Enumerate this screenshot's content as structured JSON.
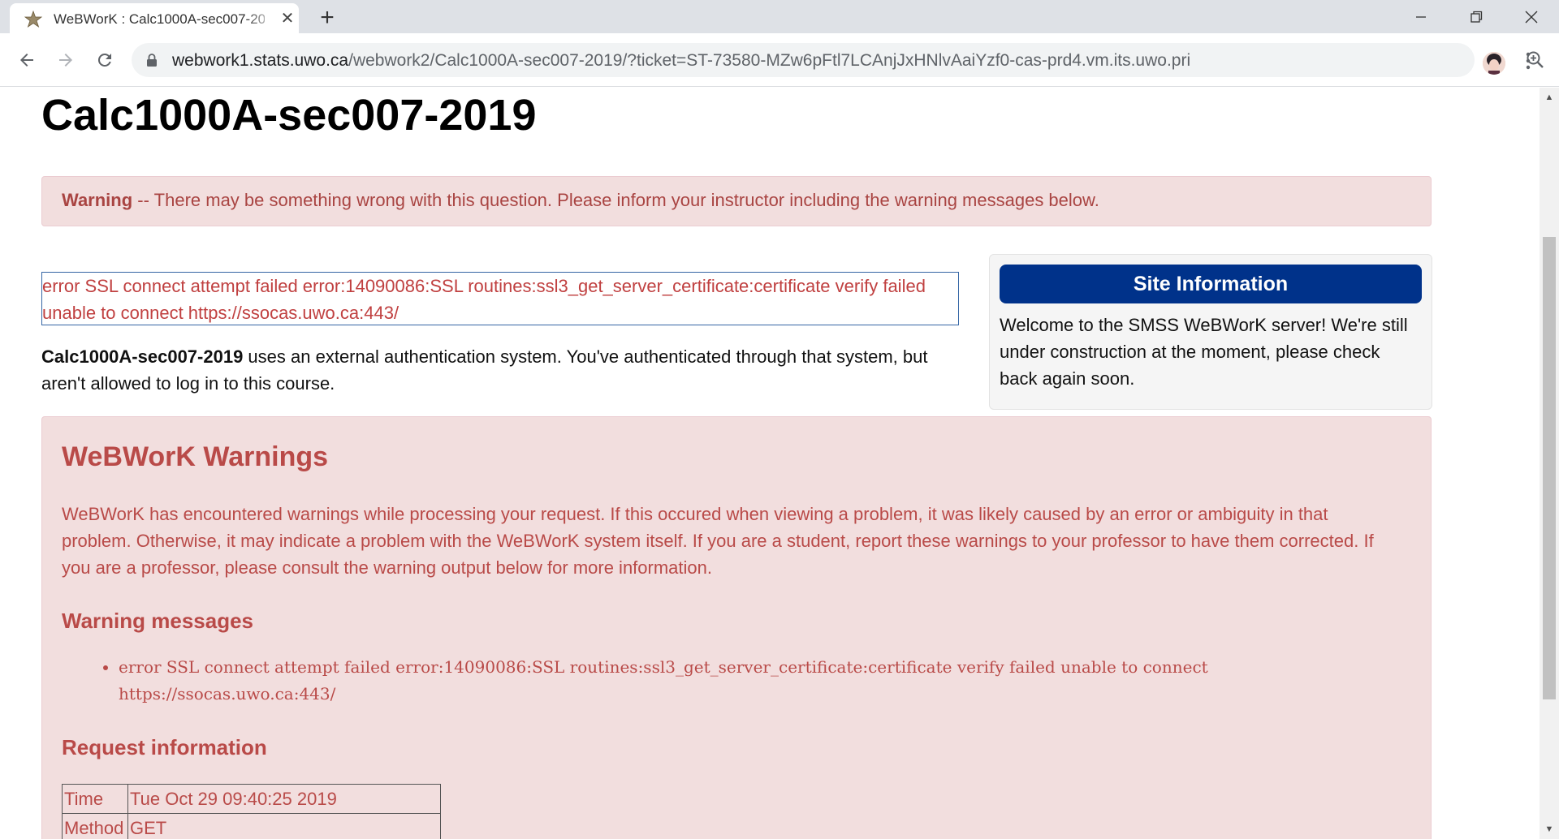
{
  "browser": {
    "tab": {
      "title": "WeBWorK : Calc1000A-sec007-2019"
    },
    "new_tab_label": "+",
    "url": {
      "host": "webwork1.stats.uwo.ca",
      "path": "/webwork2/Calc1000A-sec007-2019/?ticket=ST-73580-MZw6pFtl7LCAnjJxHNlvAaiYzf0-cas-prd4.vm.its.uwo.pri"
    },
    "icons": [
      "favicon-icon",
      "close-icon",
      "back-icon",
      "forward-icon",
      "reload-icon",
      "lock-icon",
      "zoom-icon",
      "star-icon",
      "avatar",
      "menu-icon",
      "minimize-icon",
      "maximize-icon"
    ]
  },
  "page": {
    "course_title": "Calc1000A-sec007-2019",
    "warning_alert": {
      "label": "Warning",
      "text": " -- There may be something wrong with this question. Please inform your instructor including the warning messages below."
    },
    "ssl_error": "error SSL connect attempt failed error:14090086:SSL routines:ssl3_get_server_certificate:certificate verify failed unable to connect https://ssocas.uwo.ca:443/",
    "auth_message": {
      "course": "Calc1000A-sec007-2019",
      "text": " uses an external authentication system. You've authenticated through that system, but aren't allowed to log in to this course."
    },
    "site_info": {
      "header": "Site Information",
      "body": "Welcome to the SMSS WeBWorK server! We're still under construction at the moment, please check back again soon."
    },
    "webwork_warnings": {
      "title": "WeBWorK Warnings",
      "intro": "WeBWorK has encountered warnings while processing your request. If this occured when viewing a problem, it was likely caused by an error or ambiguity in that problem. Otherwise, it may indicate a problem with the WeBWorK system itself. If you are a student, report these warnings to your professor to have them corrected. If you are a professor, please consult the warning output below for more information.",
      "messages_heading": "Warning messages",
      "messages": [
        "error SSL connect attempt failed error:14090086:SSL routines:ssl3_get_server_certificate:certificate verify failed unable to connect https://ssocas.uwo.ca:443/"
      ],
      "request_heading": "Request information",
      "request_rows": [
        {
          "key": "Time",
          "value": "Tue Oct 29 09:40:25 2019"
        },
        {
          "key": "Method",
          "value": "GET"
        }
      ]
    }
  },
  "colors": {
    "alert_bg": "#f2dede",
    "alert_text": "#a94442",
    "site_info_header": "#00328a"
  }
}
